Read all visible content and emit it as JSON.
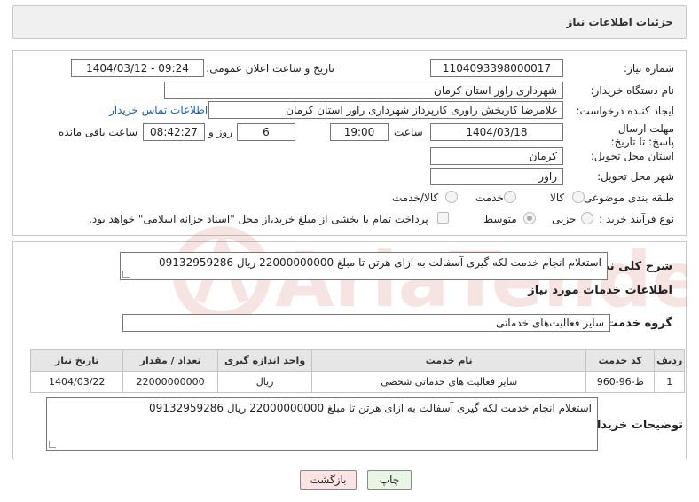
{
  "header": {
    "title": "جزئیات اطلاعات نیاز"
  },
  "form": {
    "need_number_label": "شماره نیاز:",
    "need_number": "1104093398000017",
    "announce_label": "تاریخ و ساعت اعلان عمومی:",
    "announce_value": "1404/03/12 - 09:24",
    "buyer_org_label": "نام دستگاه خریدار:",
    "buyer_org": "شهرداری راور استان کرمان",
    "creator_label": "ایجاد کننده درخواست:",
    "creator": "غلامرضا کاربخش راوری کارپرداز  شهرداری راور استان کرمان",
    "contact_link": "اطلاعات تماس خریدار",
    "deadline_label": "مهلت ارسال پاسخ: تا تاریخ:",
    "deadline_date": "1404/03/18",
    "time_label": "ساعت",
    "deadline_time": "19:00",
    "days_value": "6",
    "days_label": "روز و",
    "remaining_time": "08:42:27",
    "remaining_label": "ساعت باقی مانده",
    "province_label": "استان محل تحویل:",
    "province": "کرمان",
    "city_label": "شهر محل تحویل:",
    "city": "راور",
    "category_label": "طبقه بندی موضوعی:",
    "category_options": [
      "کالا",
      "خدمت",
      "کالا/خدمت"
    ],
    "purchase_type_label": "نوع فرآیند خرید :",
    "purchase_options": [
      "جزیی",
      "متوسط"
    ],
    "payment_note": "پرداخت تمام یا بخشی از مبلغ خرید،از محل \"اسناد خزانه اسلامی\" خواهد بود."
  },
  "summary": {
    "label": "شرح کلی نیاز:",
    "text": "استعلام انجام خدمت لکه گیری آسفالت  به ازای هرتن  تا مبلغ 22000000000 ریال 09132959286"
  },
  "services": {
    "section_title": "اطلاعات خدمات مورد نیاز",
    "group_label": "گروه خدمت:",
    "group_value": "سایر فعالیت‌های خدماتی",
    "columns": [
      "ردیف",
      "کد خدمت",
      "نام خدمت",
      "واحد اندازه گیری",
      "تعداد / مقدار",
      "تاریخ نیاز"
    ],
    "rows": [
      [
        "1",
        "ط-96-960",
        "سایر فعالیت های خدماتی شخصی",
        "ریال",
        "22000000000",
        "1404/03/22"
      ]
    ]
  },
  "buyer_notes": {
    "label": "توضیحات خریدار:",
    "text": "استعلام انجام خدمت لکه گیری آسفالت  به ازای هرتن  تا مبلغ 22000000000 ریال 09132959286"
  },
  "buttons": {
    "print": "چاپ",
    "back": "بازگشت"
  },
  "colors": {
    "back_button_bg": "#fde3e3",
    "print_button_bg": "#eaf6e5",
    "watermark": "#c0392b"
  }
}
